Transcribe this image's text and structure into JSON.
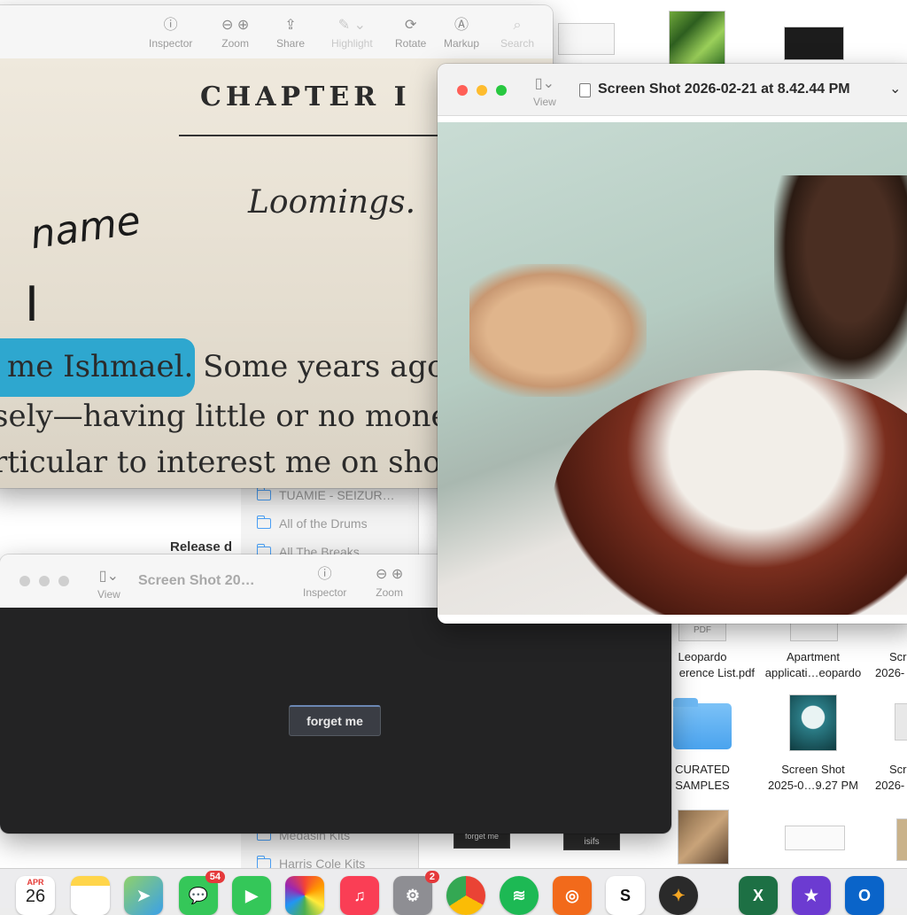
{
  "finder": {
    "sidebar_items": [
      "TUAMIE - SEIZUR…",
      "All of the Drums",
      "All The Breaks",
      "Medasin Kits",
      "Harris Cole Kits"
    ],
    "release_label": "Release d",
    "files": [
      {
        "line1": "PDF",
        "line2": "",
        "name1": "Leopardo",
        "name2": "erence List.pdf"
      },
      {
        "line1": "",
        "line2": "",
        "name1": "Apartment",
        "name2": "applicati…eopardo"
      },
      {
        "line1": "",
        "line2": "",
        "name1": "Scr",
        "name2": "2026-"
      },
      {
        "line1": "",
        "line2": "",
        "name1": "CURATED",
        "name2": "SAMPLES"
      },
      {
        "line1": "",
        "line2": "",
        "name1": "Screen Shot",
        "name2": "2025-0…9.27 PM"
      },
      {
        "line1": "",
        "line2": "",
        "name1": "Scr",
        "name2": "2026-"
      }
    ],
    "thumb_forget_label": "forget me",
    "thumb_isifs_label": "isifs"
  },
  "preview_back": {
    "toolbar": {
      "inspector": "Inspector",
      "zoom": "Zoom",
      "share": "Share",
      "highlight": "Highlight",
      "rotate": "Rotate",
      "markup": "Markup",
      "search": "Search"
    },
    "book": {
      "chapter": "CHAPTER I",
      "subtitle": "Loomings.",
      "handwriting1": "name",
      "handwriting2": "I",
      "line1_highlight": "me Ishmael.",
      "line1_rest": "Some years ago—",
      "line2": "sely—having little or no money",
      "line3": "rticular to interest me on sho"
    }
  },
  "preview_front": {
    "view_label": "View",
    "title": "Screen Shot 2026-02-21 at 8.42.44 PM"
  },
  "preview_dark": {
    "view_label": "View",
    "title": "Screen Shot 20…",
    "inspector": "Inspector",
    "zoom": "Zoom",
    "button_label": "forget me"
  },
  "dock": {
    "calendar_month": "APR",
    "calendar_day": "26",
    "messages_badge": "54",
    "settings_badge": "2"
  }
}
